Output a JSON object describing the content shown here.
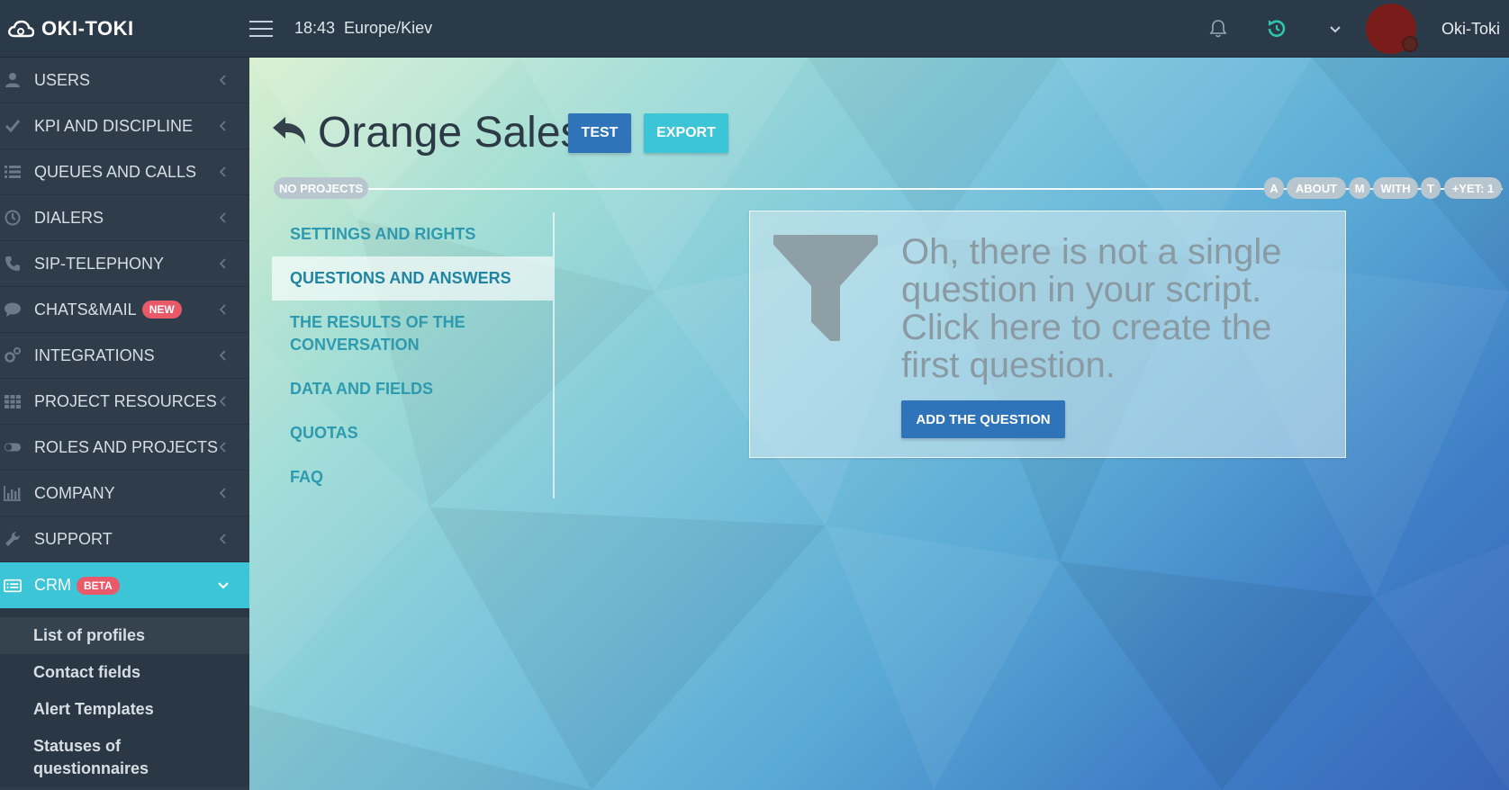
{
  "topbar": {
    "logo_text": "OKI-TOKI",
    "time": "18:43",
    "timezone": "Europe/Kiev",
    "username": "Oki-Toki"
  },
  "sidebar": {
    "items": [
      {
        "label": "USERS",
        "icon": "user-icon"
      },
      {
        "label": "KPI AND DISCIPLINE",
        "icon": "check-icon"
      },
      {
        "label": "QUEUES AND CALLS",
        "icon": "list-icon"
      },
      {
        "label": "DIALERS",
        "icon": "clock-icon"
      },
      {
        "label": "SIP-TELEPHONY",
        "icon": "phone-icon"
      },
      {
        "label": "CHATS&MAIL",
        "icon": "chat-icon",
        "badge": "NEW"
      },
      {
        "label": "INTEGRATIONS",
        "icon": "gears-icon"
      },
      {
        "label": "PROJECT RESOURCES",
        "icon": "grid-icon"
      },
      {
        "label": "ROLES AND PROJECTS",
        "icon": "toggle-icon"
      },
      {
        "label": "COMPANY",
        "icon": "bar-chart-icon"
      },
      {
        "label": "SUPPORT",
        "icon": "wrench-icon"
      },
      {
        "label": "CRM",
        "icon": "crm-icon",
        "badge": "BETA"
      }
    ],
    "submenu": [
      "List of profiles",
      "Contact fields",
      "Alert Templates",
      "Statuses of questionnaires"
    ]
  },
  "main": {
    "title": "Orange Sales",
    "test_label": "TEST",
    "export_label": "EXPORT",
    "project_pill": "NO PROJECTS",
    "right_pills": [
      "A",
      "ABOUT",
      "M",
      "WITH",
      "T",
      "+YET: 1"
    ],
    "tabs": [
      "SETTINGS AND RIGHTS",
      "QUESTIONS AND ANSWERS",
      "THE RESULTS OF THE CONVERSATION",
      "DATA AND FIELDS",
      "QUOTAS",
      "FAQ"
    ],
    "empty_message": "Oh, there is not a single question in your script. Click here to create the first question.",
    "add_button_label": "ADD THE QUESTION"
  },
  "colors": {
    "accent": "#3cc5d6",
    "primary_button": "#2f73b8",
    "badge": "#e85a6a",
    "sidebar": "#2f3d4b"
  }
}
